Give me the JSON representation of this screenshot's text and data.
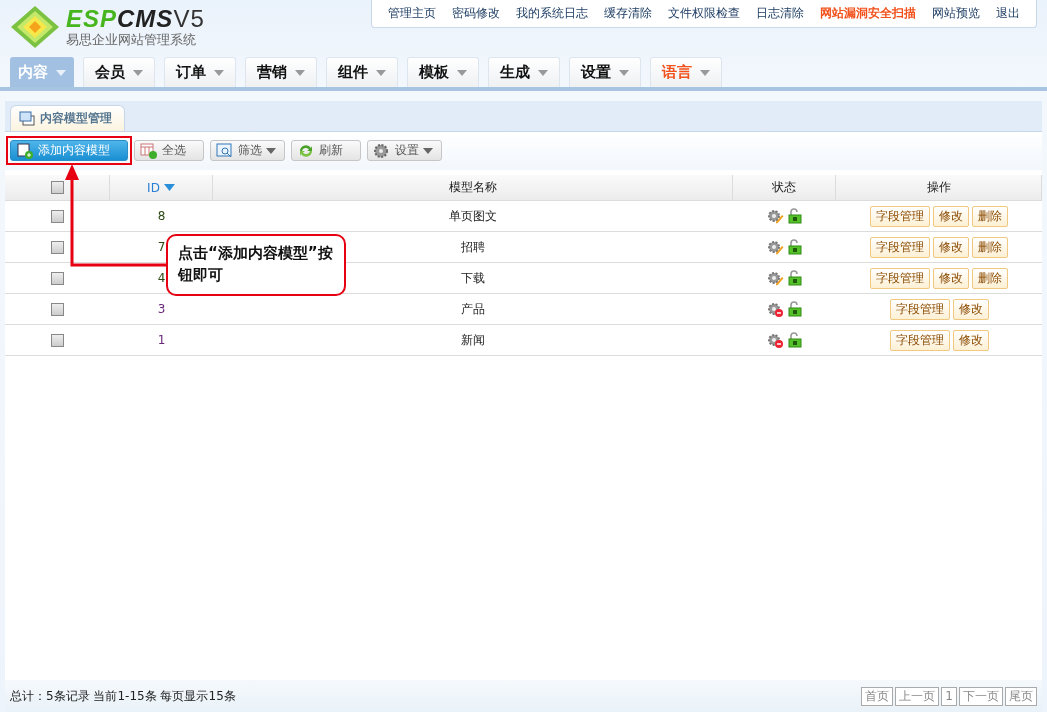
{
  "logo": {
    "brand_a": "ESP",
    "brand_b": "CMS",
    "version": "V5",
    "subtitle": "易思企业网站管理系统"
  },
  "top_links": [
    {
      "label": "管理主页",
      "highlight": false
    },
    {
      "label": "密码修改",
      "highlight": false
    },
    {
      "label": "我的系统日志",
      "highlight": false
    },
    {
      "label": "缓存清除",
      "highlight": false
    },
    {
      "label": "文件权限检查",
      "highlight": false
    },
    {
      "label": "日志清除",
      "highlight": false
    },
    {
      "label": "网站漏洞安全扫描",
      "highlight": true
    },
    {
      "label": "网站预览",
      "highlight": false
    },
    {
      "label": "退出",
      "highlight": false
    }
  ],
  "nav_tabs": [
    {
      "label": "内容",
      "selected": true,
      "highlight": false
    },
    {
      "label": "会员",
      "selected": false,
      "highlight": false
    },
    {
      "label": "订单",
      "selected": false,
      "highlight": false
    },
    {
      "label": "营销",
      "selected": false,
      "highlight": false
    },
    {
      "label": "组件",
      "selected": false,
      "highlight": false
    },
    {
      "label": "模板",
      "selected": false,
      "highlight": false
    },
    {
      "label": "生成",
      "selected": false,
      "highlight": false
    },
    {
      "label": "设置",
      "selected": false,
      "highlight": false
    },
    {
      "label": "语言",
      "selected": false,
      "highlight": true
    }
  ],
  "panel_tab": "内容模型管理",
  "toolbar": [
    {
      "label": "添加内容模型",
      "kind": "add",
      "primary": true,
      "dropdown": false
    },
    {
      "label": "全选",
      "kind": "select",
      "primary": false,
      "dropdown": false
    },
    {
      "label": "筛选",
      "kind": "filter",
      "primary": false,
      "dropdown": true
    },
    {
      "label": "刷新",
      "kind": "refresh",
      "primary": false,
      "dropdown": false
    },
    {
      "label": "设置",
      "kind": "settings",
      "primary": false,
      "dropdown": true
    }
  ],
  "table": {
    "columns": [
      "ID",
      "模型名称",
      "状态",
      "操作"
    ],
    "header_checked": false,
    "rows": [
      {
        "checked": false,
        "id": "8",
        "name": "单页图文",
        "kind": "editable",
        "actions": [
          "字段管理",
          "修改",
          "删除"
        ]
      },
      {
        "checked": false,
        "id": "7",
        "name": "招聘",
        "kind": "editable",
        "actions": [
          "字段管理",
          "修改",
          "删除"
        ]
      },
      {
        "checked": false,
        "id": "4",
        "name": "下载",
        "kind": "editable",
        "actions": [
          "字段管理",
          "修改",
          "删除"
        ]
      },
      {
        "checked": false,
        "id": "3",
        "name": "产品",
        "kind": "system",
        "actions": [
          "字段管理",
          "修改"
        ]
      },
      {
        "checked": false,
        "id": "1",
        "name": "新闻",
        "kind": "system",
        "actions": [
          "字段管理",
          "修改"
        ]
      }
    ]
  },
  "callout": "点击“添加内容模型”按钮即可",
  "status_bar": "总计：5条记录 当前1-15条 每页显示15条",
  "pagination": [
    "首页",
    "上一页",
    "1",
    "下一页",
    "尾页"
  ]
}
